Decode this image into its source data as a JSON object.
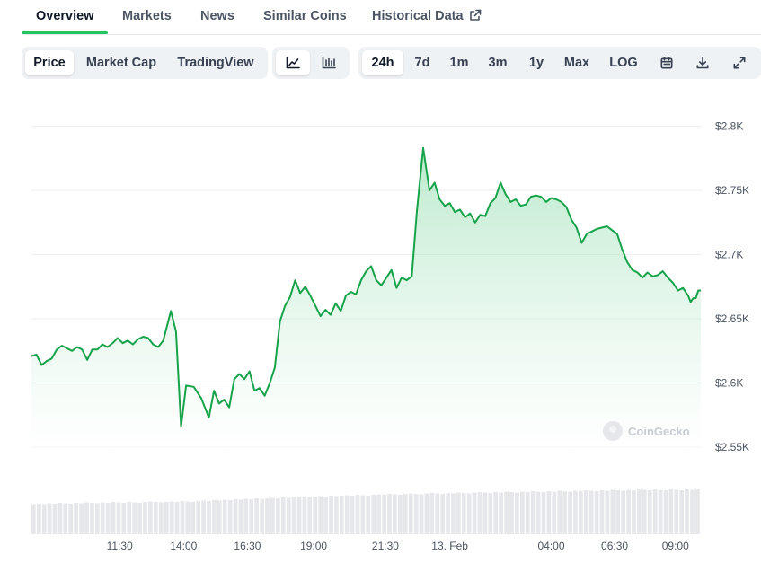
{
  "tabs": [
    {
      "label": "Overview",
      "active": true
    },
    {
      "label": "Markets"
    },
    {
      "label": "News"
    },
    {
      "label": "Similar Coins"
    },
    {
      "label": "Historical Data",
      "icon": "external-link-icon"
    }
  ],
  "metric_toggle": [
    {
      "label": "Price",
      "active": true
    },
    {
      "label": "Market Cap"
    },
    {
      "label": "TradingView"
    }
  ],
  "chart_style_toggle": [
    {
      "icon": "line-chart-icon",
      "active": true
    },
    {
      "icon": "candlestick-chart-icon"
    }
  ],
  "range_toggle": [
    {
      "label": "24h",
      "active": true
    },
    {
      "label": "7d"
    },
    {
      "label": "1m"
    },
    {
      "label": "3m"
    },
    {
      "label": "1y"
    },
    {
      "label": "Max"
    },
    {
      "label": "LOG"
    }
  ],
  "toolbar_icons": [
    "calendar-icon",
    "download-icon",
    "expand-icon"
  ],
  "watermark": "CoinGecko",
  "colors": {
    "line": "#16a34a",
    "fill_top": "#86d9a4",
    "volume": "#e5e7eb",
    "grid": "#eceef1",
    "accent": "#22c55e"
  },
  "chart_data": {
    "type": "area",
    "ylim": [
      2535,
      2800
    ],
    "y_ticks": [
      {
        "value": 2800,
        "label": "$2.8K"
      },
      {
        "value": 2750,
        "label": "$2.75K"
      },
      {
        "value": 2700,
        "label": "$2.7K"
      },
      {
        "value": 2650,
        "label": "$2.65K"
      },
      {
        "value": 2600,
        "label": "$2.6K"
      },
      {
        "value": 2550,
        "label": "$2.55K"
      }
    ],
    "x_ticks": [
      {
        "label": "11:30",
        "pos": 3.48
      },
      {
        "label": "14:00",
        "pos": 6.0
      },
      {
        "label": "16:30",
        "pos": 8.52
      },
      {
        "label": "19:00",
        "pos": 11.13
      },
      {
        "label": "21:30",
        "pos": 13.96
      },
      {
        "label": "13. Feb",
        "pos": 16.5
      },
      {
        "label": "04:00",
        "pos": 20.5
      },
      {
        "label": "06:30",
        "pos": 23.0
      },
      {
        "label": "09:00",
        "pos": 25.4
      }
    ],
    "x_unit": "hours from 08:00, 12 Feb",
    "price": [
      [
        0.0,
        2621
      ],
      [
        0.2,
        2622
      ],
      [
        0.4,
        2614
      ],
      [
        0.6,
        2617
      ],
      [
        0.8,
        2619
      ],
      [
        1.0,
        2626
      ],
      [
        1.2,
        2629
      ],
      [
        1.4,
        2627
      ],
      [
        1.6,
        2625
      ],
      [
        1.8,
        2628
      ],
      [
        2.0,
        2626
      ],
      [
        2.2,
        2618
      ],
      [
        2.4,
        2626
      ],
      [
        2.6,
        2626
      ],
      [
        2.8,
        2630
      ],
      [
        3.0,
        2628
      ],
      [
        3.2,
        2631
      ],
      [
        3.4,
        2635
      ],
      [
        3.6,
        2631
      ],
      [
        3.8,
        2633
      ],
      [
        4.0,
        2630
      ],
      [
        4.2,
        2634
      ],
      [
        4.4,
        2636
      ],
      [
        4.6,
        2635
      ],
      [
        4.8,
        2630
      ],
      [
        5.0,
        2628
      ],
      [
        5.2,
        2633
      ],
      [
        5.5,
        2656
      ],
      [
        5.7,
        2640
      ],
      [
        5.9,
        2566
      ],
      [
        6.1,
        2598
      ],
      [
        6.4,
        2597
      ],
      [
        6.7,
        2588
      ],
      [
        7.0,
        2573
      ],
      [
        7.2,
        2594
      ],
      [
        7.4,
        2584
      ],
      [
        7.6,
        2587
      ],
      [
        7.8,
        2581
      ],
      [
        8.0,
        2603
      ],
      [
        8.2,
        2607
      ],
      [
        8.4,
        2603
      ],
      [
        8.6,
        2609
      ],
      [
        8.8,
        2594
      ],
      [
        9.0,
        2596
      ],
      [
        9.2,
        2590
      ],
      [
        9.4,
        2600
      ],
      [
        9.6,
        2612
      ],
      [
        9.8,
        2648
      ],
      [
        10.0,
        2660
      ],
      [
        10.2,
        2667
      ],
      [
        10.4,
        2680
      ],
      [
        10.6,
        2670
      ],
      [
        10.8,
        2675
      ],
      [
        11.0,
        2668
      ],
      [
        11.2,
        2660
      ],
      [
        11.4,
        2652
      ],
      [
        11.6,
        2657
      ],
      [
        11.8,
        2653
      ],
      [
        12.0,
        2662
      ],
      [
        12.2,
        2656
      ],
      [
        12.4,
        2668
      ],
      [
        12.6,
        2671
      ],
      [
        12.8,
        2669
      ],
      [
        13.0,
        2680
      ],
      [
        13.2,
        2687
      ],
      [
        13.4,
        2691
      ],
      [
        13.6,
        2680
      ],
      [
        13.8,
        2676
      ],
      [
        14.0,
        2682
      ],
      [
        14.2,
        2688
      ],
      [
        14.4,
        2674
      ],
      [
        14.6,
        2682
      ],
      [
        14.8,
        2680
      ],
      [
        15.0,
        2683
      ],
      [
        15.2,
        2733
      ],
      [
        15.45,
        2783
      ],
      [
        15.7,
        2750
      ],
      [
        15.9,
        2756
      ],
      [
        16.1,
        2743
      ],
      [
        16.3,
        2738
      ],
      [
        16.5,
        2740
      ],
      [
        16.7,
        2733
      ],
      [
        16.9,
        2735
      ],
      [
        17.1,
        2729
      ],
      [
        17.3,
        2732
      ],
      [
        17.5,
        2725
      ],
      [
        17.7,
        2731
      ],
      [
        17.9,
        2730
      ],
      [
        18.1,
        2740
      ],
      [
        18.3,
        2744
      ],
      [
        18.5,
        2756
      ],
      [
        18.7,
        2747
      ],
      [
        18.9,
        2741
      ],
      [
        19.1,
        2743
      ],
      [
        19.3,
        2738
      ],
      [
        19.5,
        2739
      ],
      [
        19.7,
        2745
      ],
      [
        19.9,
        2746
      ],
      [
        20.1,
        2745
      ],
      [
        20.3,
        2741
      ],
      [
        20.5,
        2744
      ],
      [
        20.7,
        2743
      ],
      [
        20.9,
        2741
      ],
      [
        21.1,
        2737
      ],
      [
        21.3,
        2727
      ],
      [
        21.5,
        2721
      ],
      [
        21.7,
        2709
      ],
      [
        21.9,
        2716
      ],
      [
        22.1,
        2718
      ],
      [
        22.3,
        2720
      ],
      [
        22.5,
        2721
      ],
      [
        22.7,
        2722
      ],
      [
        22.9,
        2719
      ],
      [
        23.1,
        2716
      ],
      [
        23.3,
        2704
      ],
      [
        23.5,
        2694
      ],
      [
        23.7,
        2688
      ],
      [
        23.9,
        2686
      ],
      [
        24.1,
        2682
      ],
      [
        24.3,
        2686
      ],
      [
        24.5,
        2683
      ],
      [
        24.7,
        2684
      ],
      [
        24.9,
        2687
      ],
      [
        25.1,
        2682
      ],
      [
        25.3,
        2678
      ],
      [
        25.5,
        2672
      ],
      [
        25.7,
        2674
      ],
      [
        25.9,
        2668
      ],
      [
        26.0,
        2663
      ],
      [
        26.1,
        2666
      ],
      [
        26.2,
        2666
      ],
      [
        26.3,
        2672
      ],
      [
        26.4,
        2672
      ]
    ],
    "volume_relative": [
      0.67,
      0.68,
      0.67,
      0.69,
      0.68,
      0.7,
      0.69,
      0.68,
      0.7,
      0.69,
      0.71,
      0.7,
      0.69,
      0.71,
      0.7,
      0.72,
      0.71,
      0.7,
      0.72,
      0.71,
      0.7,
      0.72,
      0.73,
      0.72,
      0.71,
      0.72,
      0.73,
      0.72,
      0.74,
      0.73,
      0.72,
      0.74,
      0.75,
      0.74,
      0.76,
      0.75,
      0.77,
      0.76,
      0.78,
      0.77,
      0.79,
      0.78,
      0.8,
      0.79,
      0.8,
      0.81,
      0.8,
      0.82,
      0.81,
      0.83,
      0.82,
      0.84,
      0.83,
      0.84,
      0.85,
      0.84,
      0.86,
      0.85,
      0.86,
      0.87,
      0.86,
      0.88,
      0.87,
      0.86,
      0.88,
      0.89,
      0.88,
      0.9,
      0.89,
      0.88,
      0.9,
      0.91,
      0.9,
      0.89,
      0.91,
      0.92,
      0.91,
      0.9,
      0.92,
      0.91,
      0.93,
      0.92,
      0.91,
      0.93,
      0.94,
      0.93,
      0.92,
      0.94,
      0.93,
      0.95,
      0.94,
      0.93,
      0.95,
      0.94,
      0.96,
      0.95,
      0.94,
      0.96,
      0.95,
      0.97,
      0.96,
      0.95,
      0.97,
      0.96,
      0.98,
      0.97,
      0.96,
      0.98,
      0.97,
      0.99,
      0.98,
      0.97,
      0.99,
      0.98,
      1.0,
      0.99,
      0.98,
      1.0,
      0.99,
      0.98,
      1.0,
      0.99,
      0.98,
      1.0,
      0.99,
      1.0
    ]
  }
}
